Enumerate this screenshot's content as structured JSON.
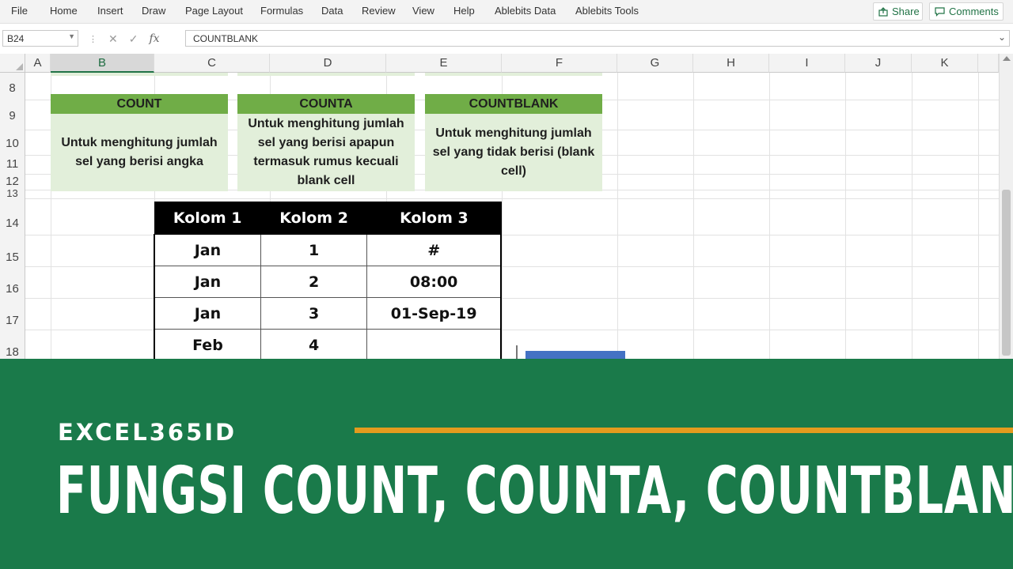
{
  "ribbon": {
    "tabs": [
      "File",
      "Home",
      "Insert",
      "Draw",
      "Page Layout",
      "Formulas",
      "Data",
      "Review",
      "View",
      "Help",
      "Ablebits Data",
      "Ablebits Tools"
    ],
    "share_label": "Share",
    "comments_label": "Comments"
  },
  "formula_bar": {
    "name_box": "B24",
    "fx_label": "fx",
    "formula": "COUNTBLANK"
  },
  "grid": {
    "columns": [
      "A",
      "B",
      "C",
      "D",
      "E",
      "F",
      "G",
      "H",
      "I",
      "J",
      "K"
    ],
    "selected_column": "B",
    "rows": [
      "8",
      "9",
      "10",
      "11",
      "12",
      "13",
      "14",
      "15",
      "16",
      "17",
      "18"
    ]
  },
  "info_boxes": [
    {
      "title": "COUNT",
      "text": "Untuk menghitung jumlah sel yang berisi angka"
    },
    {
      "title": "COUNTA",
      "text": "Untuk menghitung jumlah sel yang berisi apapun termasuk rumus kecuali blank cell"
    },
    {
      "title": "COUNTBLANK",
      "text": "Untuk menghitung jumlah sel yang tidak berisi (blank cell)"
    }
  ],
  "table": {
    "headers": [
      "Kolom 1",
      "Kolom 2",
      "Kolom 3"
    ],
    "rows": [
      [
        "Jan",
        "1",
        "#"
      ],
      [
        "Jan",
        "2",
        "08:00"
      ],
      [
        "Jan",
        "3",
        "01-Sep-19"
      ],
      [
        "Feb",
        "4",
        ""
      ]
    ]
  },
  "banner": {
    "brand": "EXCEL365ID",
    "headline": "FUNGSI COUNT, COUNTA, COUNTBLANK"
  },
  "colors": {
    "banner_green": "#1a7a4a",
    "header_green": "#70ad47",
    "box_green": "#e2efda",
    "orange_rule": "#e39b1e",
    "shape_blue": "#4472c4"
  }
}
